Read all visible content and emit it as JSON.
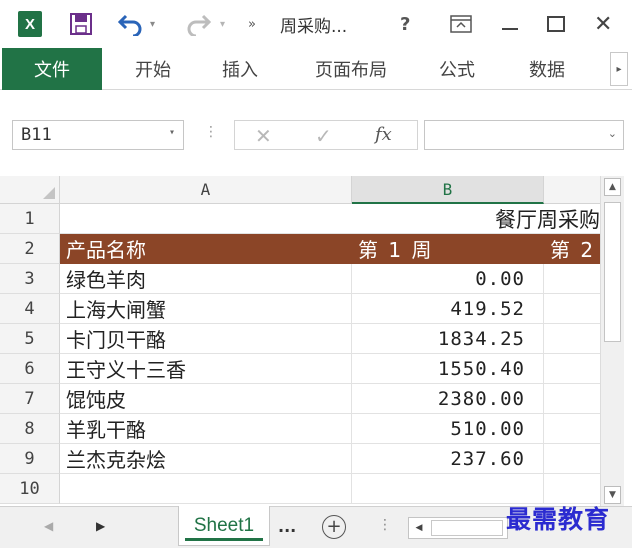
{
  "titlebar": {
    "app_icon_letter": "X",
    "title": "周采购...",
    "more_glyph": "»",
    "help_glyph": "?",
    "close_glyph": "✕",
    "dropdown_glyph": "▾"
  },
  "ribbon": {
    "tabs": [
      {
        "label": "文件"
      },
      {
        "label": "开始"
      },
      {
        "label": "插入"
      },
      {
        "label": "页面布局"
      },
      {
        "label": "公式"
      },
      {
        "label": "数据"
      }
    ],
    "scroll_glyph": "▸"
  },
  "formula_bar": {
    "name_box": "B11",
    "fx_label": "fx",
    "cancel_glyph": "✕",
    "enter_glyph": "✓",
    "formula_value": ""
  },
  "grid": {
    "columns": [
      "A",
      "B"
    ],
    "selected_column": "B",
    "row_numbers": [
      "1",
      "2",
      "3",
      "4",
      "5",
      "6",
      "7",
      "8",
      "9",
      "10"
    ],
    "title_text": "餐厅周采购",
    "header": {
      "a": "产品名称",
      "b": "第 1 周",
      "c": "第 2"
    },
    "rows": [
      {
        "a": "绿色羊肉",
        "b": "0.00"
      },
      {
        "a": "上海大闸蟹",
        "b": "419.52"
      },
      {
        "a": "卡门贝干酪",
        "b": "1834.25"
      },
      {
        "a": "王守义十三香",
        "b": "1550.40"
      },
      {
        "a": "馄饨皮",
        "b": "2380.00"
      },
      {
        "a": "羊乳干酪",
        "b": "510.00"
      },
      {
        "a": "兰杰克杂烩",
        "b": "237.60"
      }
    ]
  },
  "sheets": {
    "active": "Sheet1",
    "more": "...",
    "add_glyph": "+"
  },
  "watermark": "最需教育",
  "colors": {
    "excel_green": "#217346",
    "header_row_brown": "#8b4527",
    "watermark_blue": "#2b2bd0"
  }
}
